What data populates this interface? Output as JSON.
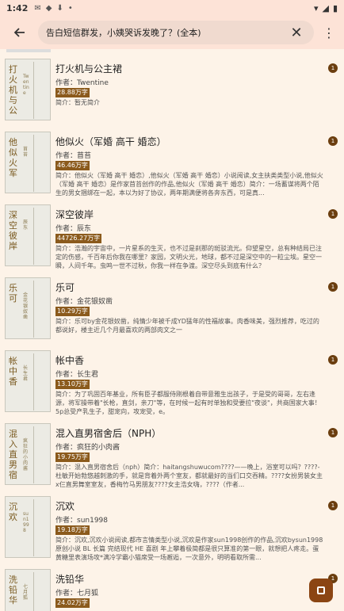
{
  "status": {
    "time": "1:42",
    "icons": [
      "gmail-icon",
      "cat-icon",
      "download-icon",
      "dot-icon"
    ],
    "right_icons": [
      "wifi-icon",
      "signal-icon",
      "battery-icon"
    ]
  },
  "search": {
    "query": "告白短信群发，小姨哭诉发晚了？(全本)"
  },
  "books": [
    {
      "title": "打火机与公主裙",
      "author": "作者：Twentine",
      "words": "28.88万字",
      "intro": "简介：暂无简介",
      "cover_title": "打火机与公",
      "cover_author": "Twentine",
      "badge": "1"
    },
    {
      "title": "他似火（军婚 高干 婚恋）",
      "author": "作者：苜苔",
      "words": "46.46万字",
      "intro": "简介：他似火（军婚 高干 婚恋）,他似火（军婚 高干 婚恋）小说阅读,女主扶类类型小说,他似火（军婚 高干 婚恋）是作家苜苔创作的作品,他似火（军婚 高干 婚恋）简介：一场蓄谋将两个陌生的男女捆绑在一起，本以为好了协议，两年期满便将各奔东西，可是真...",
      "cover_title": "他似火军",
      "cover_author": "苜苔",
      "badge": "1"
    },
    {
      "title": "深空彼岸",
      "author": "作者：辰东",
      "words": "44726.27万字",
      "intro": "简介：浩瀚的宇宙中，一片星系的生灭，也不过是刹那的斑驳流光。仰望星空，总有种结局已注定的伤感，千百年后你我在哪里？家园，文明火光，地球，都不过是深空中的一粒尘埃。星空一瞬，人间千年。虫鸣一世不过秋，你我一样在争渡。深空尽头到底有什么？",
      "cover_title": "深空彼岸",
      "cover_author": "辰东",
      "badge": "1"
    },
    {
      "title": "乐可",
      "author": "作者：金花银奴凿",
      "words": "10.29万字",
      "intro": "简介：乐可by金花银奴凿，纯情少年被千成YD猛年的性福故事。肉香味美，强烈推荐，吃过的都说好，楼主近几个月最喜欢的两部肉文之一",
      "cover_title": "乐可",
      "cover_author": "金花银奴凿",
      "badge": "1"
    },
    {
      "title": "帐中香",
      "author": "作者：长生君",
      "words": "13.10万字",
      "intro": "简介：为了巩固百年基业，所有臣子都服侍刚根着自带意雅生出孩子，于是受的哥哥，左右逢源，将军操带着\"长枪，直剑，亲刀\"等，在时候一起有时单独和受要拉\"夜谈\"，共商国家大事！5p总受产乳生子，甜宠向，攻宠受，e。",
      "cover_title": "帐中香",
      "cover_author": "长生君",
      "badge": "1"
    },
    {
      "title": "混入直男宿舍后（NPH）",
      "author": "作者：疯狂的小肉酱",
      "words": "19.75万字",
      "intro": "简介：混入直男宿舍后（nph）简介：haitangshuwucom????——晚上，浴室可以吗？????-杜敏开始勃悠越刺激的手，就是背着外两个室友，都就最好的当们口交吞精。????女扮男装女主x仨直男舞室室友，香梅竹马男朋友????女主浩女嗨，????（作者...",
      "cover_title": "混入直男宿",
      "cover_author": "疯狂的小肉酱",
      "badge": "1"
    },
    {
      "title": "沉欢",
      "author": "作者：sun1998",
      "words": "19.18万字",
      "intro": "简介：沉欢,沉欢小说阅读,都市言情类型小说,沉欢是作家sun1998创作的作品,沉欢bysun1998原创小说 BL 长篇 完结现代 HE 喜剧 年上攀着极简都是很只算准的第一眼，就想把人疼走。蛋黄糖里表演场攻*满冷学霸小猫席受一场邂逅，一次意外，明明看取所需...",
      "cover_title": "沉欢",
      "cover_author": "sun1998",
      "badge": "1"
    },
    {
      "title": "洗铅华",
      "author": "作者：七月狐",
      "words": "24.02万字",
      "intro": "",
      "cover_title": "洗铅华",
      "cover_author": "七月狐",
      "badge": "1"
    }
  ]
}
